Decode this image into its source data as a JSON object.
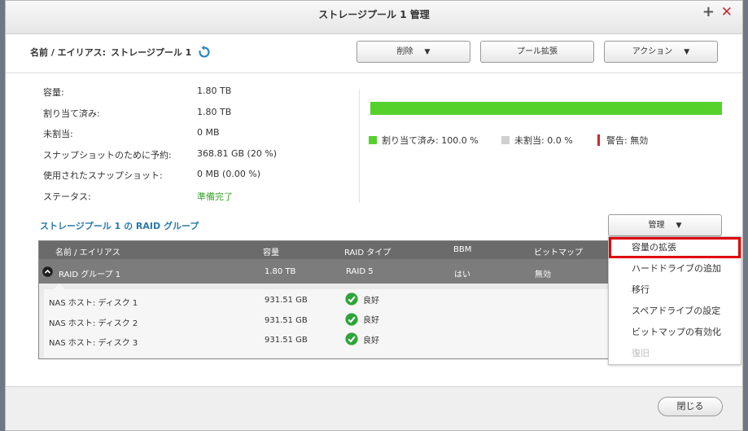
{
  "window": {
    "title": "ストレージプール 1 管理"
  },
  "pool": {
    "name_label": "名前 / エイリアス:",
    "name_value": "ストレージプール 1"
  },
  "toolbar": {
    "delete_label": "削除",
    "expand_label": "プール拡張",
    "action_label": "アクション",
    "caret": "▼"
  },
  "info": [
    {
      "key": "容量:",
      "value": "1.80 TB"
    },
    {
      "key": "割り当て済み:",
      "value": "1.80 TB"
    },
    {
      "key": "未割当:",
      "value": "0 MB"
    },
    {
      "key": "スナップショットのために予約:",
      "value": "368.81 GB (20 %)"
    },
    {
      "key": "使用されたスナップショット:",
      "value": "0 MB (0.00 %)"
    },
    {
      "key": "ステータス:",
      "value": "準備完了"
    }
  ],
  "usage": {
    "allocated_fraction": 1.0,
    "allocated_label": "割り当て済み: 100.0 %",
    "unallocated_label": "未割当: 0.0 %",
    "warning_label": "警告: 無効",
    "colors": {
      "allocated": "#55d12c",
      "unallocated": "#cfcfcf",
      "warning": "#d0262a"
    }
  },
  "raid": {
    "section_title": "ストレージプール 1 の RAID グループ",
    "manage_label": "管理",
    "columns": [
      "名前 / エイリアス",
      "容量",
      "RAID タイプ",
      "BBM",
      "ビットマップ"
    ],
    "group": {
      "name": "RAID グループ 1",
      "capacity": "1.80 TB",
      "type": "RAID 5",
      "bbm": "はい",
      "bitmap": "無効"
    },
    "disks": [
      {
        "name": "NAS ホスト: ディスク 1",
        "capacity": "931.51 GB",
        "status": "良好"
      },
      {
        "name": "NAS ホスト: ディスク 2",
        "capacity": "931.51 GB",
        "status": "良好"
      },
      {
        "name": "NAS ホスト: ディスク 3",
        "capacity": "931.51 GB",
        "status": "良好"
      }
    ]
  },
  "menu": {
    "items": [
      {
        "label": "容量の拡張",
        "state": "highlighted"
      },
      {
        "label": "ハードドライブの追加",
        "state": "enabled"
      },
      {
        "label": "移行",
        "state": "enabled"
      },
      {
        "label": "スペアドライブの設定",
        "state": "enabled"
      },
      {
        "label": "ビットマップの有効化",
        "state": "enabled"
      },
      {
        "label": "復旧",
        "state": "disabled"
      }
    ]
  },
  "footer": {
    "close_label": "閉じる"
  }
}
